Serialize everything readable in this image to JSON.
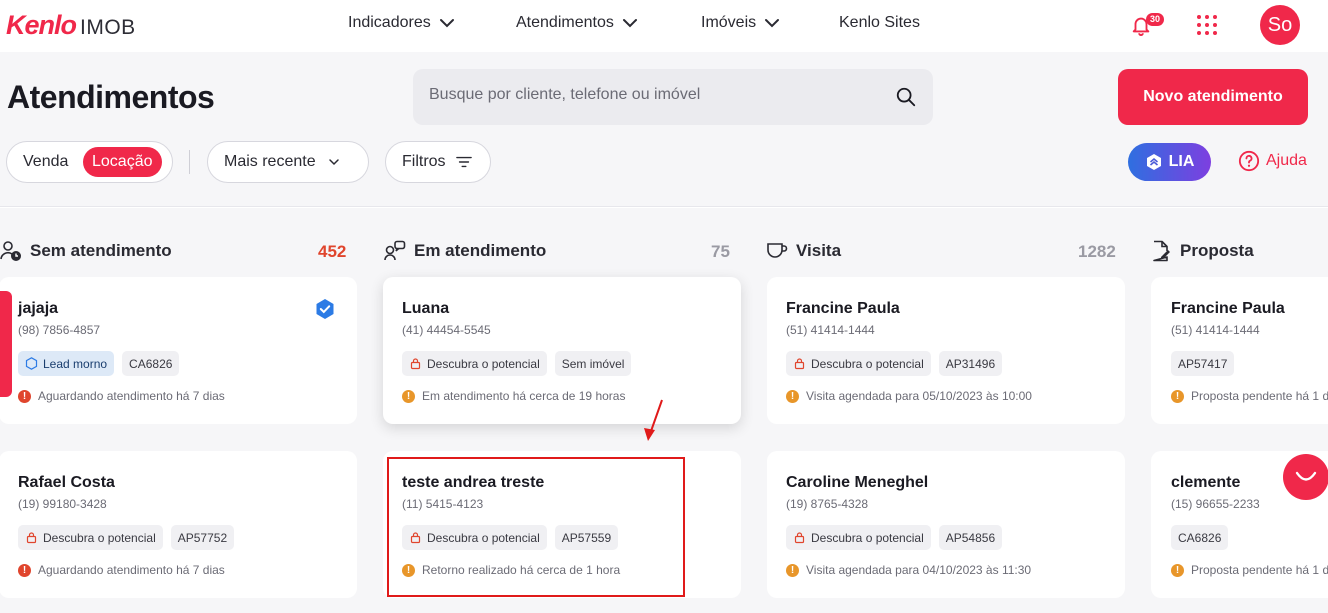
{
  "app": {
    "brand": "Kenlo",
    "product": "IMOB"
  },
  "nav": {
    "items": [
      {
        "label": "Indicadores",
        "has_dropdown": true
      },
      {
        "label": "Atendimentos",
        "has_dropdown": true
      },
      {
        "label": "Imóveis",
        "has_dropdown": true
      },
      {
        "label": "Kenlo Sites",
        "has_dropdown": false
      }
    ],
    "notifications_count": "30",
    "avatar_initials": "So"
  },
  "page": {
    "title": "Atendimentos",
    "search_placeholder": "Busque por cliente, telefone ou imóvel",
    "new_button": "Novo atendimento"
  },
  "filters": {
    "segment": [
      "Venda",
      "Locação"
    ],
    "segment_selected": "Locação",
    "sort_label": "Mais recente",
    "filters_label": "Filtros",
    "lia_label": "LIA",
    "help_label": "Ajuda"
  },
  "columns": [
    {
      "title": "Sem atendimento",
      "count": "452",
      "count_color": "#e0452d",
      "icon": "user-clock-icon"
    },
    {
      "title": "Em atendimento",
      "count": "75",
      "count_color": "#9a9aa3",
      "icon": "chat-users-icon"
    },
    {
      "title": "Visita",
      "count": "1282",
      "count_color": "#9a9aa3",
      "icon": "coffee-cup-icon"
    },
    {
      "title": "Proposta",
      "count": "",
      "count_color": "#9a9aa3",
      "icon": "document-edit-icon"
    }
  ],
  "cards": [
    {
      "name": "jajaja",
      "phone": "(98) 7856-4857",
      "tags": [
        "Lead morno",
        "CA6826"
      ],
      "status": "Aguardando atendimento há 7 dias",
      "status_color": "red",
      "verified": true
    },
    {
      "name": "Luana",
      "phone": "(41) 44454-5545",
      "tags": [
        "Descubra o potencial",
        "Sem imóvel"
      ],
      "status": "Em atendimento há cerca de 19 horas",
      "status_color": "orange"
    },
    {
      "name": "Francine Paula",
      "phone": "(51) 41414-1444",
      "tags": [
        "Descubra o potencial",
        "AP31496"
      ],
      "status": "Visita agendada para 05/10/2023 às 10:00",
      "status_color": "orange"
    },
    {
      "name": "Francine Paula",
      "phone": "(51) 41414-1444",
      "tags": [
        "AP57417"
      ],
      "status": "Proposta pendente há 1 d",
      "status_color": "orange"
    },
    {
      "name": "Rafael Costa",
      "phone": "(19) 99180-3428",
      "tags": [
        "Descubra o potencial",
        "AP57752"
      ],
      "status": "Aguardando atendimento há 7 dias",
      "status_color": "red"
    },
    {
      "name": "teste andrea treste",
      "phone": "(11) 5415-4123",
      "tags": [
        "Descubra o potencial",
        "AP57559"
      ],
      "status": "Retorno realizado há cerca de 1 hora",
      "status_color": "orange"
    },
    {
      "name": "Caroline Meneghel",
      "phone": "(19) 8765-4328",
      "tags": [
        "Descubra o potencial",
        "AP54856"
      ],
      "status": "Visita agendada para 04/10/2023 às 11:30",
      "status_color": "orange"
    },
    {
      "name": "clemente",
      "phone": "(15) 96655-2233",
      "tags": [
        "CA6826"
      ],
      "status": "Proposta pendente há 1 d",
      "status_color": "orange"
    }
  ],
  "colors": {
    "brand": "#f0284a",
    "annotation": "#e01a1a"
  }
}
